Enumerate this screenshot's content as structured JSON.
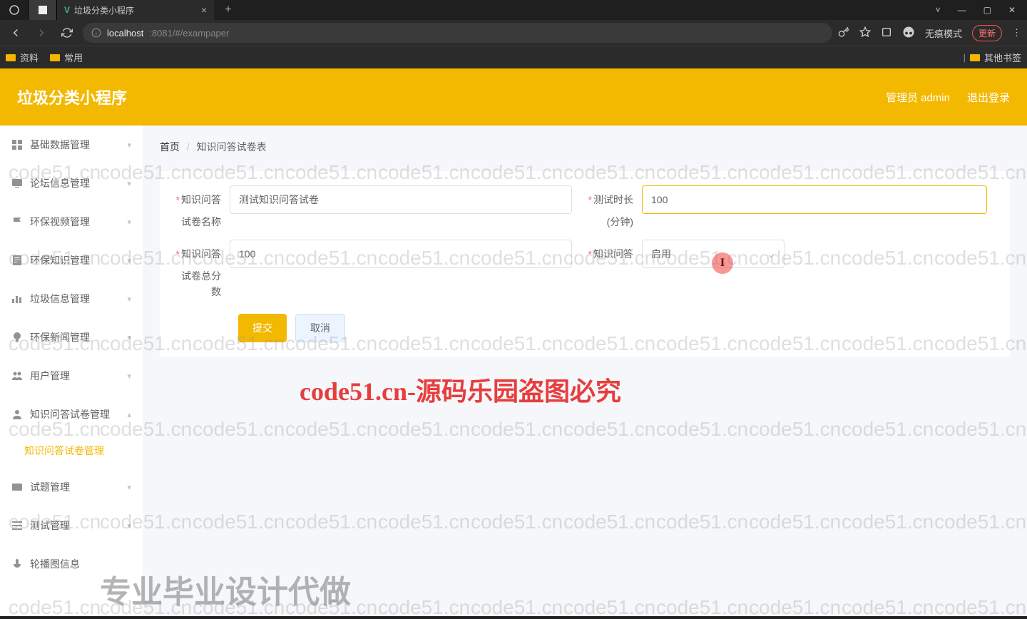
{
  "browser": {
    "tab_title": "垃圾分类小程序",
    "url_host": "localhost",
    "url_rest": ":8081/#/exampaper",
    "incognito": "无痕模式",
    "update": "更新",
    "bookmarks": {
      "b1": "资料",
      "b2": "常用",
      "other": "其他书签"
    },
    "win": {
      "min": "—",
      "max": "▢",
      "close": "✕",
      "more": "˅"
    }
  },
  "header": {
    "title": "垃圾分类小程序",
    "admin": "管理员 admin",
    "logout": "退出登录"
  },
  "sidebar": {
    "items": [
      {
        "label": "基础数据管理"
      },
      {
        "label": "论坛信息管理"
      },
      {
        "label": "环保视频管理"
      },
      {
        "label": "环保知识管理"
      },
      {
        "label": "垃圾信息管理"
      },
      {
        "label": "环保新闻管理"
      },
      {
        "label": "用户管理"
      },
      {
        "label": "知识问答试卷管理"
      },
      {
        "label": "试题管理"
      },
      {
        "label": "测试管理"
      },
      {
        "label": "轮播图信息"
      }
    ],
    "active_sub": "知识问答试卷管理"
  },
  "breadcrumb": {
    "home": "首页",
    "current": "知识问答试卷表"
  },
  "form": {
    "f1_label": "知识问答",
    "f1_sub": "试卷名称",
    "f1_value": "测试知识问答试卷",
    "f2_label": "测试时长",
    "f2_sub": "(分钟)",
    "f2_value": "100",
    "f3_label": "知识问答",
    "f3_sub": "试卷总分",
    "f3_sub2": "数",
    "f3_value": "100",
    "f4_label": "知识问答",
    "f4_value": "启用",
    "submit": "提交",
    "cancel": "取消"
  },
  "watermark": {
    "repeat": "code51.cn",
    "red": "code51.cn-源码乐园盗图必究",
    "gray": "专业毕业设计代做"
  },
  "cursor": "I"
}
